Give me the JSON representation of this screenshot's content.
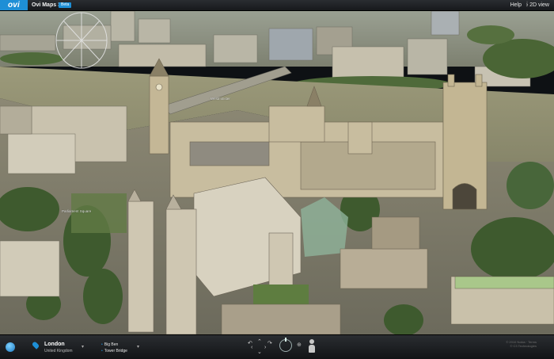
{
  "app": {
    "logo_text": "ovi",
    "title": "Ovi Maps 3D",
    "badge": "Beta"
  },
  "top_menu": {
    "help": "Help",
    "separator": "|",
    "view_toggle": "› 2D view"
  },
  "map": {
    "labels": [
      "Westminster",
      "Parliament Square"
    ]
  },
  "location": {
    "name": "London",
    "country": "United Kingdom",
    "dropdown_glyph": "▾"
  },
  "points_of_interest": [
    {
      "label": "Big Ben"
    },
    {
      "label": "Tower Bridge"
    }
  ],
  "poi_dropdown_glyph": "▾",
  "navigation": {
    "up": "⌃",
    "down": "⌄",
    "left": "‹",
    "right": "›",
    "rotate_left": "↶",
    "rotate_right": "↷",
    "zoom_glyph": "⊕"
  },
  "copyright": {
    "line1": "© 2010 Nokia · Terms",
    "line2": "© C3 Technologies"
  },
  "icons": {
    "logo": "ovi-logo-icon",
    "globe": "globe-icon",
    "pin": "location-pin-icon",
    "compass": "compass-icon",
    "person": "street-view-person-icon"
  },
  "colors": {
    "accent": "#1e8fd6",
    "bar": "#1a1c1f",
    "river": "#8a8a6e"
  }
}
